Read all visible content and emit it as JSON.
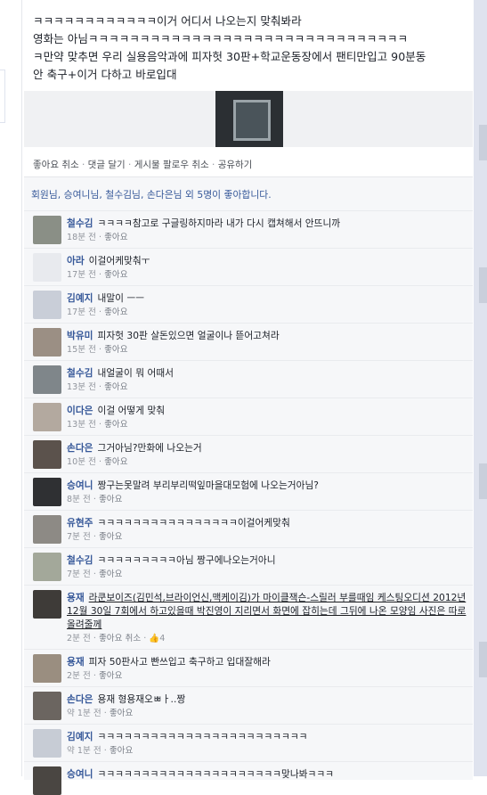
{
  "post": {
    "text_lines": [
      "ㅋㅋㅋㅋㅋㅋㅋㅋㅋㅋㅋㅋ이거 어디서 나오는지 맞춰봐라",
      "영화는 아님ㅋㅋㅋㅋㅋㅋㅋㅋㅋㅋㅋㅋㅋㅋㅋㅋㅋㅋㅋㅋㅋㅋㅋㅋㅋㅋㅋㅋㅋㅋㅋ",
      "ㅋ만약 맞추면 우리 실용음악과에 피자헛 30판+학교운동장에서 팬티만입고 90분동",
      "안 축구+이거 다하고 바로입대"
    ],
    "actions": [
      "좋아요 취소",
      "댓글 달기",
      "게시물 팔로우 취소",
      "공유하기"
    ],
    "action_separator": "·",
    "likes_summary": "회원님, 승여니님, 철수김님, 손다은님 외 5명이 좋아합니다."
  },
  "comments": [
    {
      "author": "철수김",
      "text": "ㅋㅋㅋㅋ참고로 구글링하지마라 내가 다시 캡쳐해서 안뜨니까",
      "time": "18분 전",
      "like": "좋아요"
    },
    {
      "author": "아라",
      "text": "이걸어케맞춰ㅜ",
      "time": "17분 전",
      "like": "좋아요"
    },
    {
      "author": "김예지",
      "text": "내말이 ㅡㅡ",
      "time": "17분 전",
      "like": "좋아요"
    },
    {
      "author": "박유미",
      "text": "피자헛 30판 살돈있으면 얼굴이나 뜯어고쳐라",
      "time": "15분 전",
      "like": "좋아요"
    },
    {
      "author": "철수김",
      "text": "내얼굴이 뭐 어때서",
      "time": "13분 전",
      "like": "좋아요"
    },
    {
      "author": "이다은",
      "text": "이걸 어떻게 맞춰",
      "time": "13분 전",
      "like": "좋아요"
    },
    {
      "author": "손다은",
      "text": "그거아님?만화에 나오는거",
      "time": "10분 전",
      "like": "좋아요"
    },
    {
      "author": "승여니",
      "text": "짱구는못말려 부리부리떡잎마을대모험에 나오는거아님?",
      "time": "8분 전",
      "like": "좋아요"
    },
    {
      "author": "유현주",
      "text": "ㅋㅋㅋㅋㅋㅋㅋㅋㅋㅋㅋㅋㅋㅋㅋㅋ이걸어케맞춰",
      "time": "7분 전",
      "like": "좋아요"
    },
    {
      "author": "철수김",
      "text": "ㅋㅋㅋㅋㅋㅋㅋㅋㅋ아님 짱구에나오는거아니",
      "time": "7분 전",
      "like": "좋아요"
    },
    {
      "author": "용재",
      "text": "라쿤보이즈(김민석,브라이언신,맥케이김)가 마이클잭슨-스릴러 부를때임 케스팅오디션 2012년 12월 30일 7회에서 하고있을때 박진영이 지리면서 화면에 잡히는데 그뒤에 나온 모양임 사진은 따로 올려줄께",
      "time": "2분 전",
      "like": "좋아요 취소",
      "like_count": "4"
    },
    {
      "author": "용재",
      "text": "피자 50판사고 빤쓰입고 축구하고 입대잘해라",
      "time": "2분 전",
      "like": "좋아요"
    },
    {
      "author": "손다은",
      "text": "용재 형용재오ㅃㅏ..짱",
      "time": "약 1분 전",
      "like": "좋아요"
    },
    {
      "author": "김예지",
      "text": "ㅋㅋㅋㅋㅋㅋㅋㅋㅋㅋㅋㅋㅋㅋㅋㅋㅋㅋㅋㅋㅋㅋㅋㅋ",
      "time": "약 1분 전",
      "like": "좋아요"
    },
    {
      "author": "승여니",
      "text": "ㅋㅋㅋㅋㅋㅋㅋㅋㅋㅋㅋㅋㅋㅋㅋㅋㅋㅋㅋㅋㅋ맞나봐ㅋㅋㅋ",
      "time": "",
      "like": ""
    }
  ],
  "colors": {
    "link": "#365899",
    "meta": "#90949c",
    "comment_bg": "#f6f7f9"
  }
}
